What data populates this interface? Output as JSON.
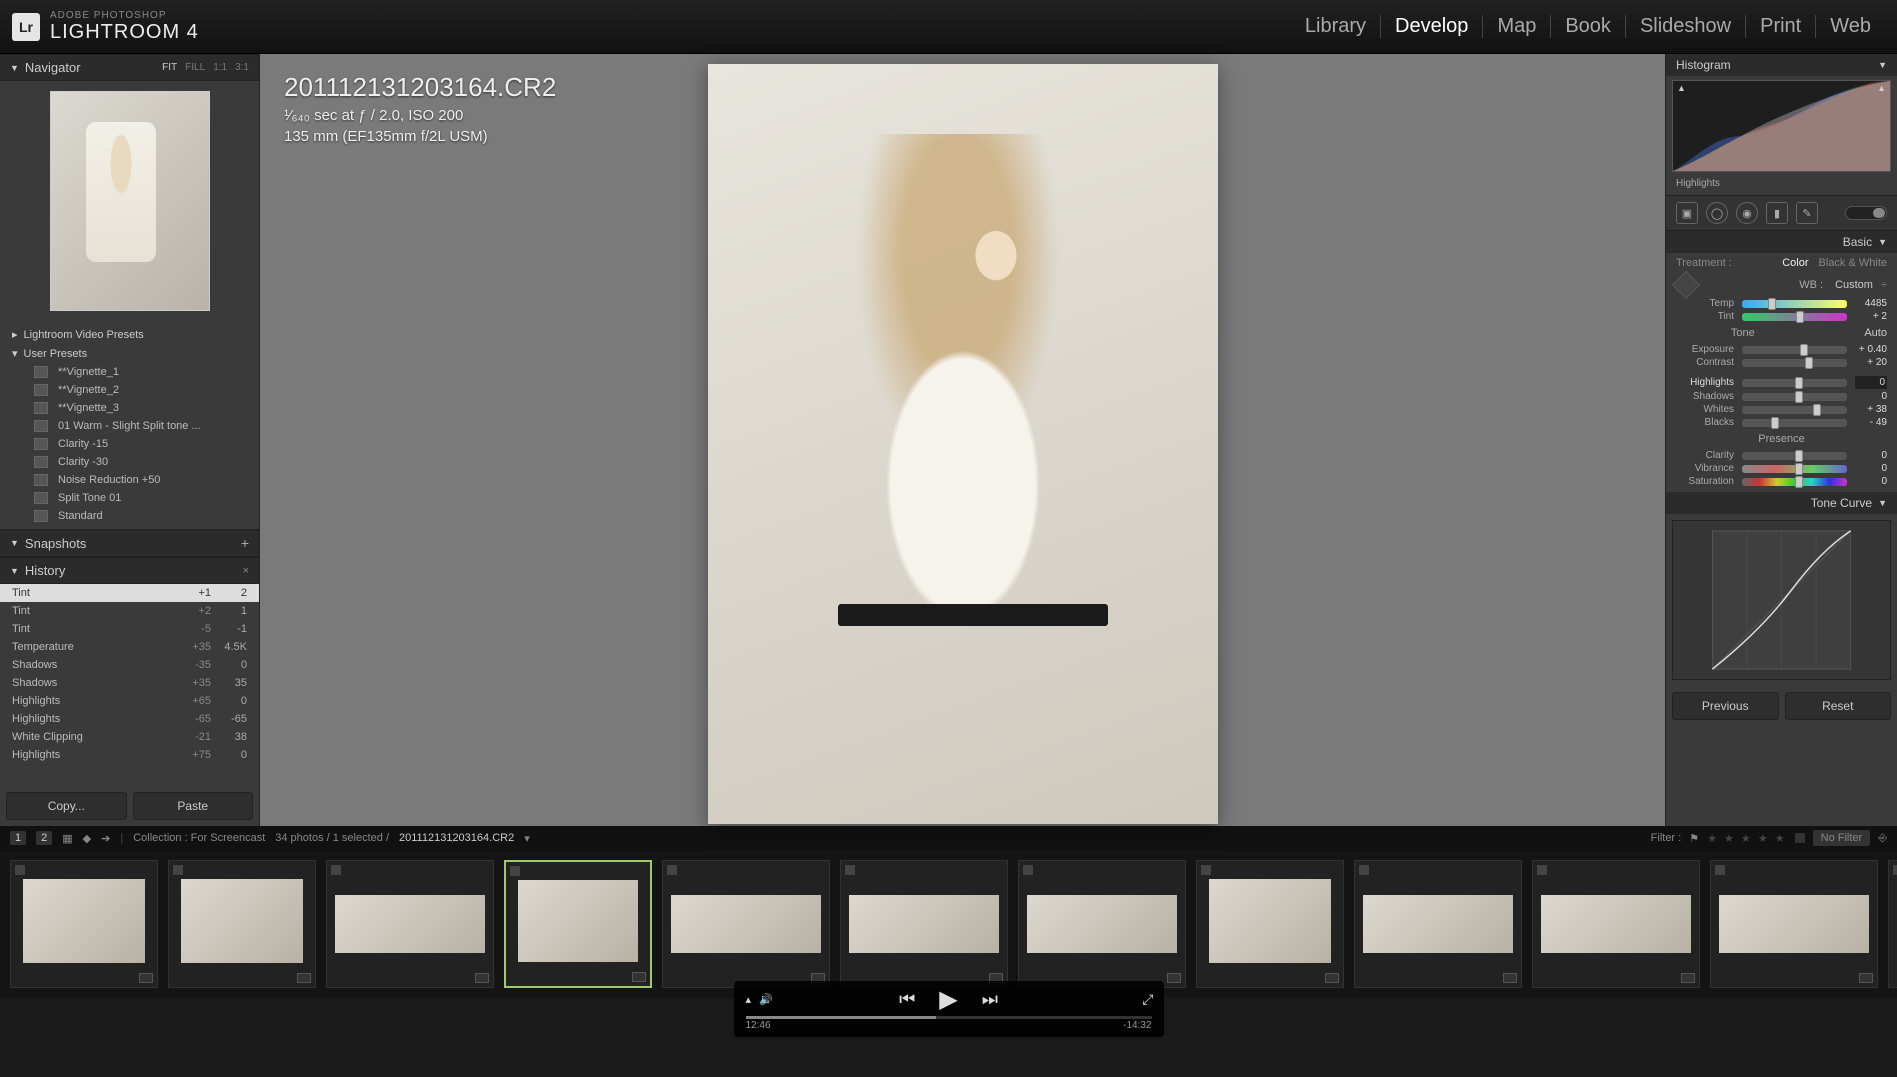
{
  "topbar": {
    "logo_badge": "Lr",
    "brand_sub": "ADOBE PHOTOSHOP",
    "brand_main": "LIGHTROOM 4",
    "modules": [
      "Library",
      "Develop",
      "Map",
      "Book",
      "Slideshow",
      "Print",
      "Web"
    ],
    "active_module": "Develop"
  },
  "left": {
    "navigator_label": "Navigator",
    "fit_modes": [
      "FIT",
      "FILL",
      "1:1",
      "3:1"
    ],
    "presets_folder_1": "Lightroom Video Presets",
    "presets_folder_2": "User Presets",
    "presets": [
      "**Vignette_1",
      "**Vignette_2",
      "**Vignette_3",
      "01 Warm - Slight Split tone ...",
      "Clarity -15",
      "Clarity -30",
      "Noise Reduction +50",
      "Split Tone 01",
      "Standard"
    ],
    "snapshots_label": "Snapshots",
    "history_label": "History",
    "history": [
      {
        "name": "Tint",
        "d": "+1",
        "v": "2",
        "sel": true
      },
      {
        "name": "Tint",
        "d": "+2",
        "v": "1"
      },
      {
        "name": "Tint",
        "d": "-5",
        "v": "-1"
      },
      {
        "name": "Temperature",
        "d": "+35",
        "v": "4.5K"
      },
      {
        "name": "Shadows",
        "d": "-35",
        "v": "0"
      },
      {
        "name": "Shadows",
        "d": "+35",
        "v": "35"
      },
      {
        "name": "Highlights",
        "d": "+65",
        "v": "0"
      },
      {
        "name": "Highlights",
        "d": "-65",
        "v": "-65"
      },
      {
        "name": "White Clipping",
        "d": "-21",
        "v": "38"
      },
      {
        "name": "Highlights",
        "d": "+75",
        "v": "0"
      }
    ],
    "copy_label": "Copy...",
    "paste_label": "Paste"
  },
  "center": {
    "filename": "201112131203164.CR2",
    "meta_line1": "¹⁄₆₄₀ sec at ƒ / 2.0, ISO 200",
    "meta_line2": "135 mm (EF135mm f/2L USM)"
  },
  "right": {
    "histogram_label": "Histogram",
    "histo_hover": "Highlights",
    "basic_label": "Basic",
    "treatment_label": "Treatment :",
    "treatment_color": "Color",
    "treatment_bw": "Black & White",
    "wb_label": "WB :",
    "wb_value": "Custom",
    "sliders": {
      "temp": {
        "lbl": "Temp",
        "val": "4485",
        "pos": 25
      },
      "tint": {
        "lbl": "Tint",
        "val": "+ 2",
        "pos": 51
      },
      "exposure": {
        "lbl": "Exposure",
        "val": "+ 0.40",
        "pos": 55
      },
      "contrast": {
        "lbl": "Contrast",
        "val": "+ 20",
        "pos": 60
      },
      "highlights": {
        "lbl": "Highlights",
        "val": "0",
        "pos": 50,
        "box": true
      },
      "shadows": {
        "lbl": "Shadows",
        "val": "0",
        "pos": 50
      },
      "whites": {
        "lbl": "Whites",
        "val": "+ 38",
        "pos": 68
      },
      "blacks": {
        "lbl": "Blacks",
        "val": "- 49",
        "pos": 28
      },
      "clarity": {
        "lbl": "Clarity",
        "val": "0",
        "pos": 50
      },
      "vibrance": {
        "lbl": "Vibrance",
        "val": "0",
        "pos": 50
      },
      "saturation": {
        "lbl": "Saturation",
        "val": "0",
        "pos": 50
      }
    },
    "tone_label": "Tone",
    "auto_label": "Auto",
    "presence_label": "Presence",
    "tonecurve_label": "Tone Curve",
    "previous_label": "Previous",
    "reset_label": "Reset"
  },
  "infobar": {
    "view1": "1",
    "view2": "2",
    "collection_label": "Collection : For Screencast",
    "count_label": "34 photos / 1 selected /",
    "selected_file": "201112131203164.CR2",
    "filter_label": "Filter :",
    "nofilter_label": "No Filter"
  },
  "video": {
    "elapsed": "12:46",
    "remaining": "-14:32"
  }
}
